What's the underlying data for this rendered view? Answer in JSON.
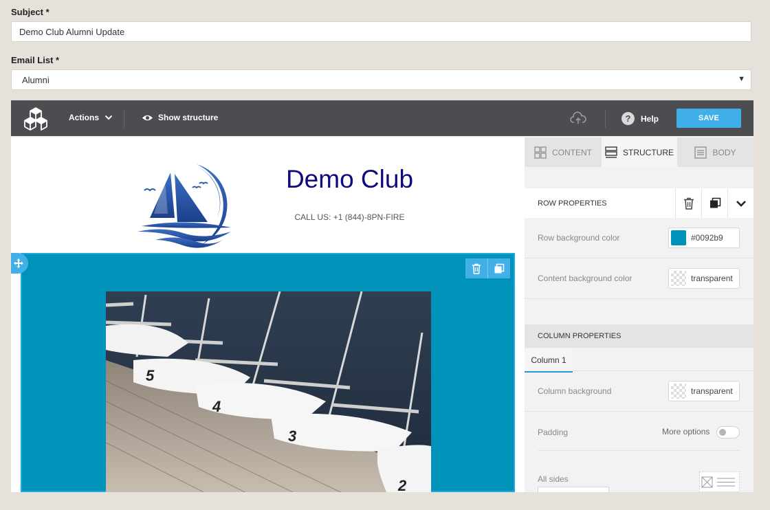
{
  "form": {
    "subject_label": "Subject *",
    "subject_value": "Demo Club Alumni Update",
    "email_list_label": "Email List *",
    "email_list_value": "Alumni"
  },
  "toolbar": {
    "actions_label": "Actions",
    "show_structure_label": "Show structure",
    "help_label": "Help",
    "help_icon_char": "?",
    "save_label": "SAVE"
  },
  "canvas": {
    "club_title": "Demo Club",
    "call_text": "CALL US: +1 (844)-8PN-FIRE"
  },
  "panel": {
    "tabs": [
      {
        "label": "CONTENT",
        "icon": "grid-icon"
      },
      {
        "label": "STRUCTURE",
        "icon": "rows-icon"
      },
      {
        "label": "BODY",
        "icon": "document-icon"
      }
    ],
    "active_tab": "STRUCTURE",
    "row_properties_label": "ROW PROPERTIES",
    "row_bg_label": "Row background color",
    "row_bg_value": "#0092b9",
    "content_bg_label": "Content background color",
    "content_bg_value": "transparent",
    "column_properties_label": "COLUMN PROPERTIES",
    "column_tab_label": "Column 1",
    "column_bg_label": "Column background",
    "column_bg_value": "transparent",
    "padding_label": "Padding",
    "more_options_label": "More options",
    "all_sides_label": "All sides"
  },
  "colors": {
    "row_background": "#0092b9",
    "accent": "#42b0e8",
    "toolbar": "#4b4d50",
    "title_navy": "#0d0a7e"
  },
  "photo": {
    "hull_numbers": [
      "5",
      "4",
      "3",
      "2"
    ]
  }
}
